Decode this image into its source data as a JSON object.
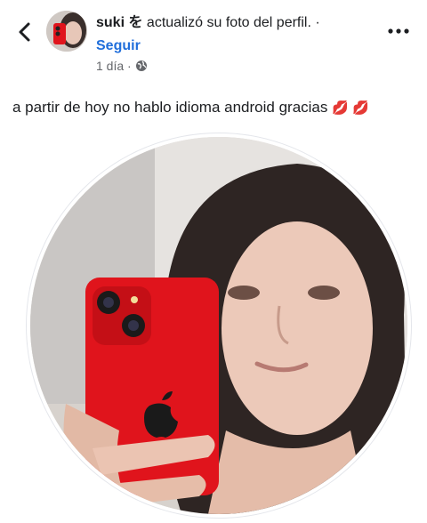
{
  "post_header": {
    "author_name": "suki を",
    "action_text": "actualizó su foto del perfil. ·",
    "follow_label": "Seguir",
    "timestamp": "1 día ·",
    "privacy_icon": "globe-icon",
    "back_icon": "chevron-left-icon",
    "more_icon": "more-dots-icon"
  },
  "post": {
    "caption": "a partir de hoy no hablo idioma android gracias",
    "emoji": "💋 💋"
  },
  "colors": {
    "link": "#216fdb",
    "meta": "#65676b",
    "phone": "#e0141c"
  }
}
